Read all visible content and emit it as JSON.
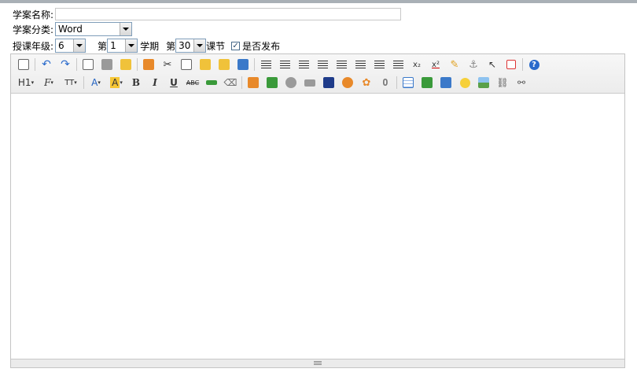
{
  "form": {
    "name_label": "学案名称:",
    "name_value": "",
    "category_label": "学案分类:",
    "category_value": "Word",
    "grade_label": "授课年级:",
    "grade_value": "6",
    "term_prefix": "第",
    "term_value": "1",
    "term_suffix": "学期",
    "lesson_prefix": "第",
    "lesson_value": "30",
    "lesson_suffix": "课节",
    "publish_label": "是否发布",
    "publish_checked": true
  },
  "toolbar": {
    "row1": [
      "source",
      "undo",
      "redo",
      "preview",
      "print",
      "templates",
      "code",
      "cut",
      "copy",
      "paste",
      "paste-text",
      "paste-word",
      "paste-plain",
      "align-left",
      "align-center",
      "align-right",
      "justify",
      "ordered-list",
      "unordered-list",
      "indent",
      "outdent",
      "subscript",
      "superscript",
      "remove-format",
      "anchor",
      "select-all",
      "fullscreen",
      "help"
    ],
    "row2": [
      "heading",
      "font-family",
      "font-size",
      "font-color",
      "highlight",
      "bold",
      "italic",
      "underline",
      "strikethrough",
      "insert-line",
      "erase",
      "insert-image",
      "insert-media",
      "insert-flash",
      "insert-video",
      "insert-flv",
      "insert-emoticon-cat",
      "insert-butterfly",
      "attachment",
      "table",
      "textfield",
      "select-box",
      "emoticon",
      "image",
      "link",
      "unlink"
    ],
    "heading_label": "H1",
    "font_family_label": "F",
    "font_size_label": "TT",
    "font_color_label": "A",
    "highlight_label": "A",
    "bold_label": "B",
    "italic_label": "I",
    "underline_label": "U",
    "strike_label": "ABC",
    "sub_label": "x₂",
    "sup_label": "x²",
    "help_label": "?"
  },
  "colors": {
    "topbar": "#a9b0b6",
    "toolbar_bg": "#f0f0f0",
    "highlight": "#f6c634",
    "font_color": "#2060c0"
  }
}
